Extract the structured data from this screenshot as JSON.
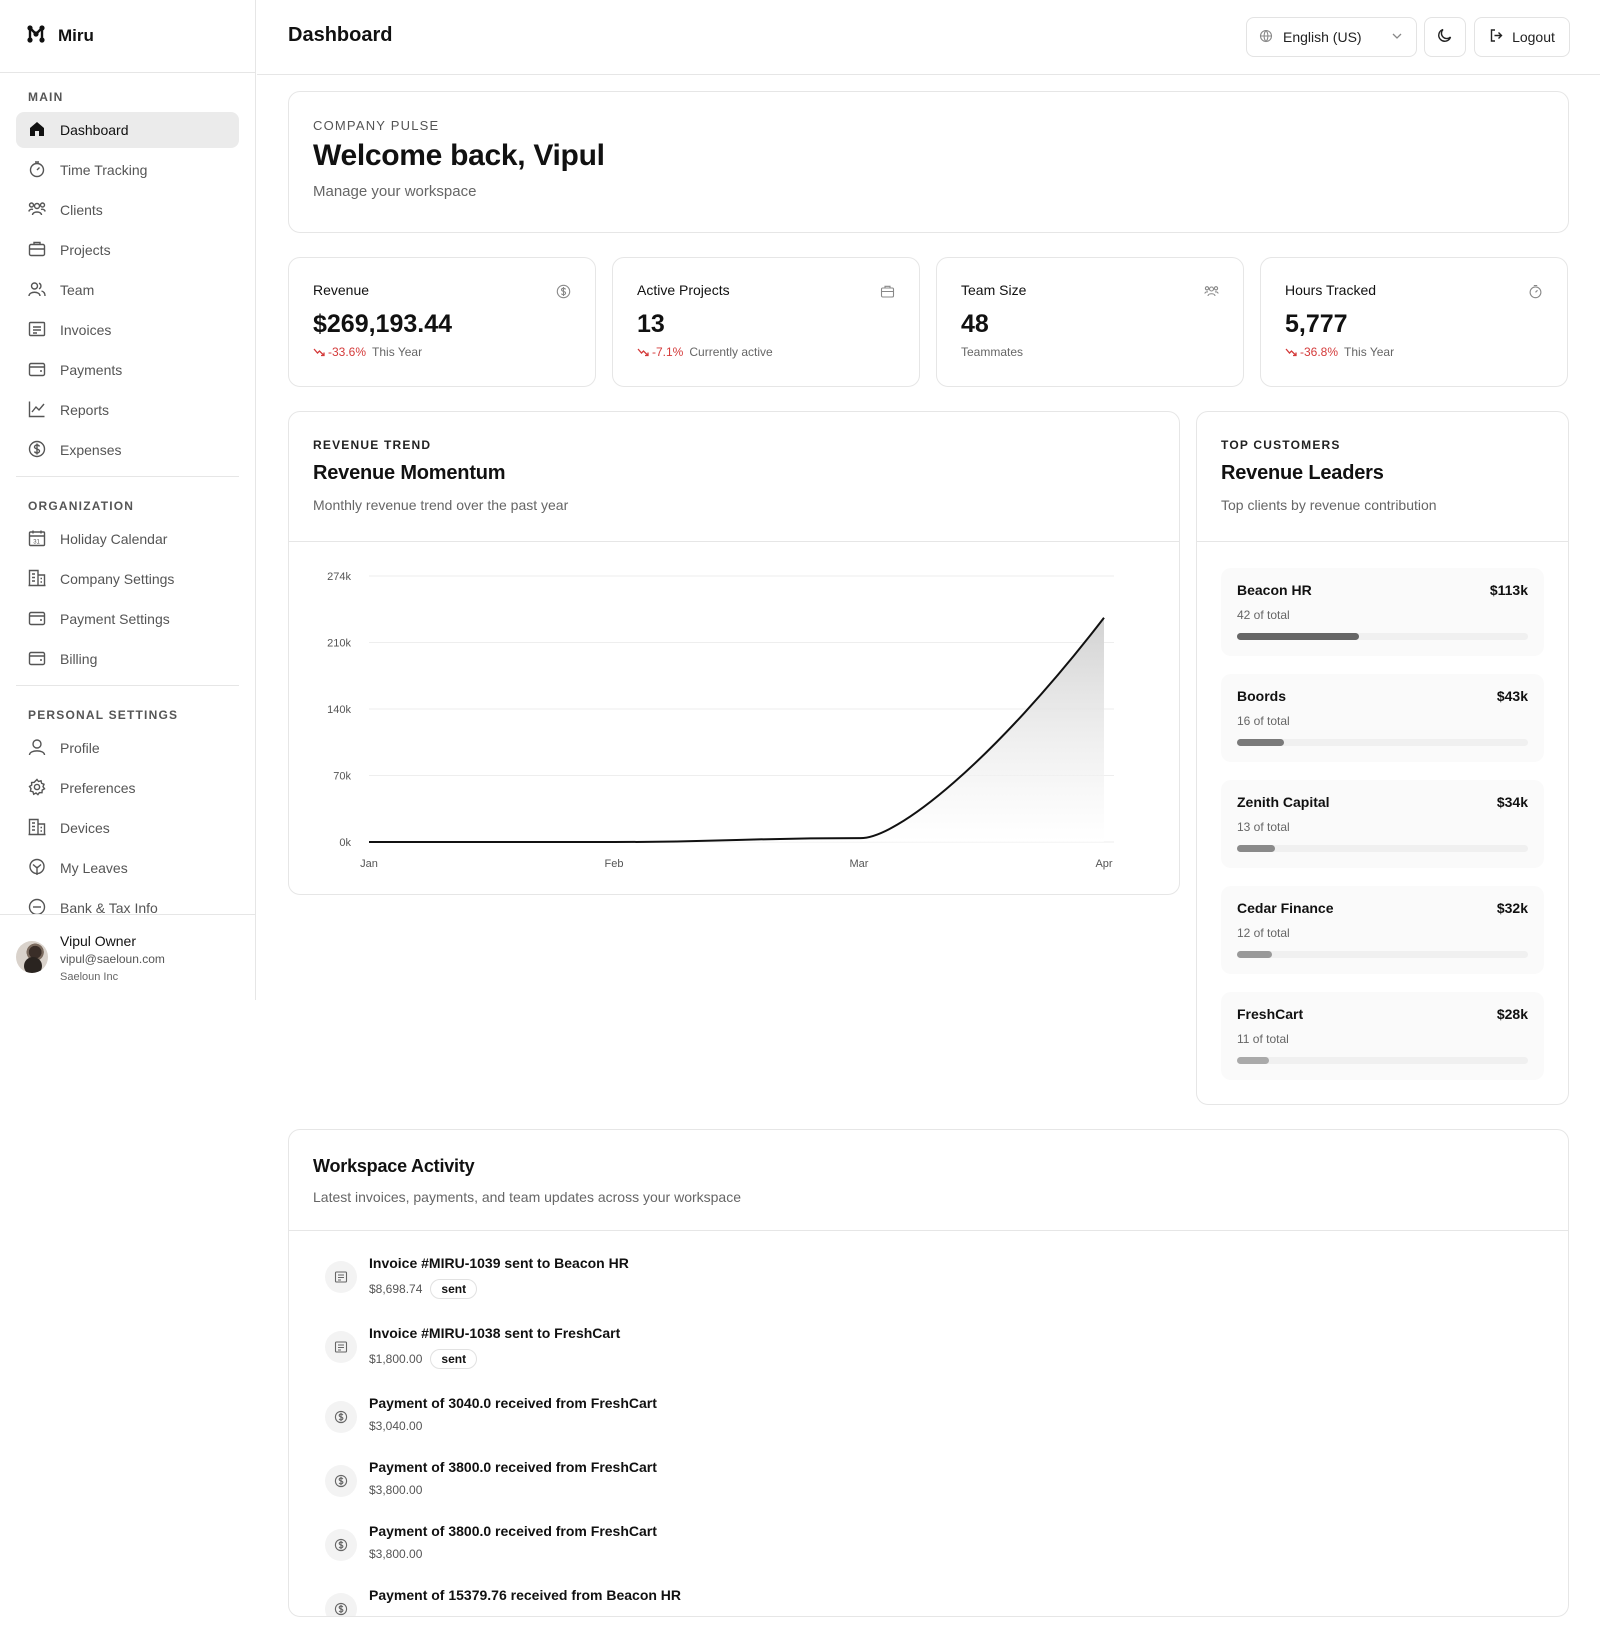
{
  "app": {
    "name": "Miru"
  },
  "header": {
    "title": "Dashboard",
    "language": "English (US)",
    "logout_label": "Logout"
  },
  "sidebar": {
    "sections": [
      {
        "label": "MAIN",
        "items": [
          "Dashboard",
          "Time Tracking",
          "Clients",
          "Projects",
          "Team",
          "Invoices",
          "Payments",
          "Reports",
          "Expenses"
        ]
      },
      {
        "label": "ORGANIZATION",
        "items": [
          "Holiday Calendar",
          "Company Settings",
          "Payment Settings",
          "Billing"
        ]
      },
      {
        "label": "PERSONAL SETTINGS",
        "items": [
          "Profile",
          "Preferences",
          "Devices",
          "My Leaves",
          "Bank & Tax Info"
        ]
      }
    ],
    "active_item": "Dashboard",
    "user": {
      "name": "Vipul Owner",
      "email": "vipul@saeloun.com",
      "org": "Saeloun Inc"
    }
  },
  "welcome": {
    "eyebrow": "COMPANY PULSE",
    "title": "Welcome back, Vipul",
    "subtitle": "Manage your workspace"
  },
  "stats": [
    {
      "label": "Revenue",
      "value": "$269,193.44",
      "change": "-33.6%",
      "period": "This Year",
      "icon": "dollar-icon"
    },
    {
      "label": "Active Projects",
      "value": "13",
      "change": "-7.1%",
      "period": "Currently active",
      "icon": "briefcase-icon"
    },
    {
      "label": "Team Size",
      "value": "48",
      "change": "",
      "period": "Teammates",
      "icon": "team-icon"
    },
    {
      "label": "Hours Tracked",
      "value": "5,777",
      "change": "-36.8%",
      "period": "This Year",
      "icon": "stopwatch-icon"
    }
  ],
  "trend": {
    "eyebrow": "REVENUE TREND",
    "title": "Revenue Momentum",
    "subtitle": "Monthly revenue trend over the past year"
  },
  "chart_data": {
    "type": "area",
    "title": "",
    "xlabel": "",
    "ylabel": "",
    "categories": [
      "Jan",
      "Feb",
      "Mar",
      "Apr"
    ],
    "series": [
      {
        "values": [
          0,
          0,
          4000,
          231000
        ]
      }
    ],
    "y_ticks": [
      "274k",
      "210k",
      "140k",
      "70k",
      "0k"
    ],
    "ylim": [
      0,
      274000
    ],
    "grid": true,
    "colors": {
      "line": "#111111",
      "fill": "#d9d9d9"
    }
  },
  "leaders": {
    "eyebrow": "TOP CUSTOMERS",
    "title": "Revenue Leaders",
    "subtitle": "Top clients by revenue contribution",
    "items": [
      {
        "name": "Beacon HR",
        "amount": "$113k",
        "share": "42 of total",
        "fraction": 0.42,
        "color": "#666666"
      },
      {
        "name": "Boords",
        "amount": "$43k",
        "share": "16 of total",
        "fraction": 0.16,
        "color": "#7a7a7a"
      },
      {
        "name": "Zenith Capital",
        "amount": "$34k",
        "share": "13 of total",
        "fraction": 0.13,
        "color": "#8a8a8a"
      },
      {
        "name": "Cedar Finance",
        "amount": "$32k",
        "share": "12 of total",
        "fraction": 0.12,
        "color": "#999999"
      },
      {
        "name": "FreshCart",
        "amount": "$28k",
        "share": "11 of total",
        "fraction": 0.11,
        "color": "#aaaaaa"
      }
    ]
  },
  "activity": {
    "title": "Workspace Activity",
    "subtitle": "Latest invoices, payments, and team updates across your workspace",
    "items": [
      {
        "title": "Invoice #MIRU-1039 sent to Beacon HR",
        "amount": "$8,698.74",
        "status": "sent",
        "icon": "invoice-icon"
      },
      {
        "title": "Invoice #MIRU-1038 sent to FreshCart",
        "amount": "$1,800.00",
        "status": "sent",
        "icon": "invoice-icon"
      },
      {
        "title": "Payment of 3040.0 received from FreshCart",
        "amount": "$3,040.00",
        "status": "",
        "icon": "dollar-icon"
      },
      {
        "title": "Payment of 3800.0 received from FreshCart",
        "amount": "$3,800.00",
        "status": "",
        "icon": "dollar-icon"
      },
      {
        "title": "Payment of 3800.0 received from FreshCart",
        "amount": "$3,800.00",
        "status": "",
        "icon": "dollar-icon"
      },
      {
        "title": "Payment of 15379.76 received from Beacon HR",
        "amount": "",
        "status": "",
        "icon": "dollar-icon"
      }
    ]
  }
}
